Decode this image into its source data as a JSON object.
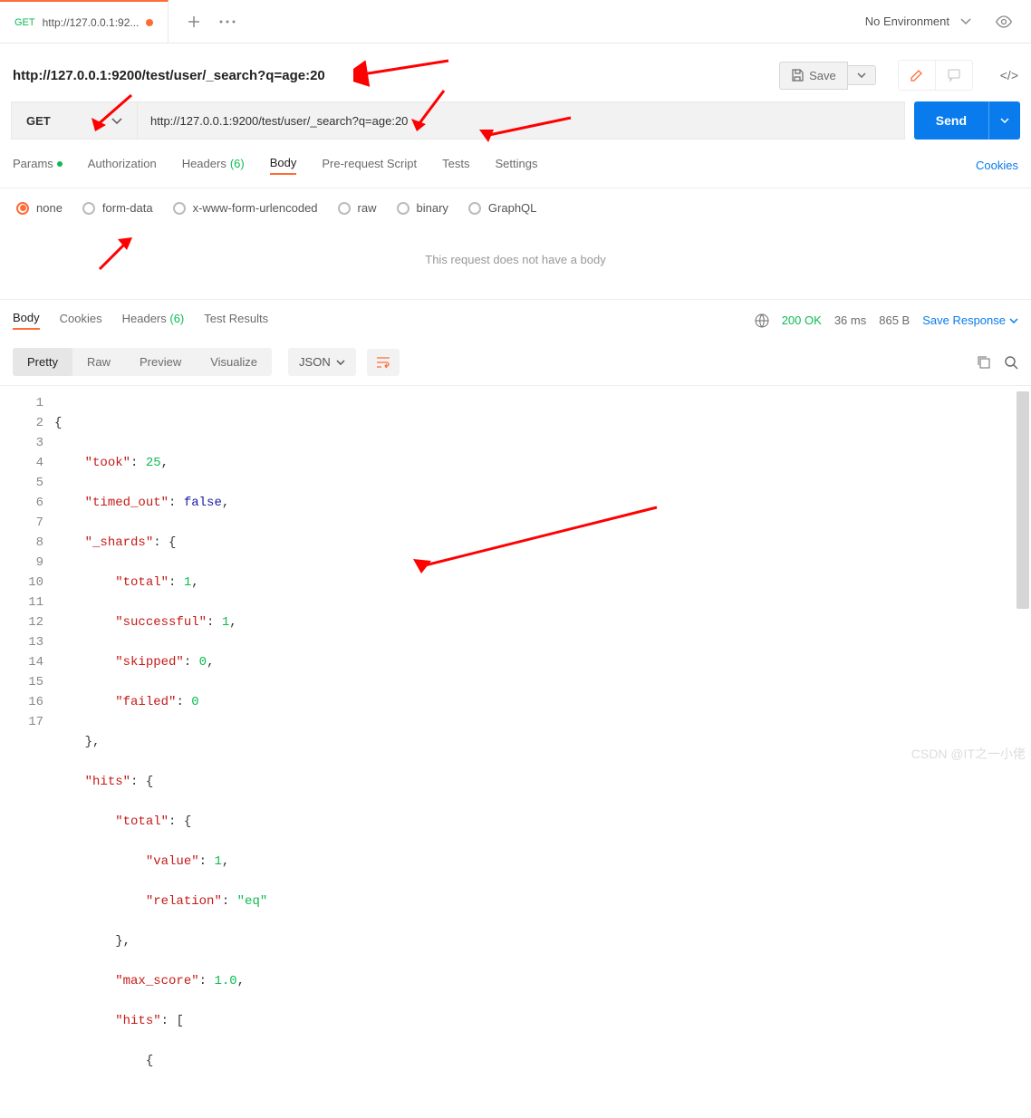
{
  "tab": {
    "method": "GET",
    "title": "http://127.0.0.1:92..."
  },
  "env": {
    "label": "No Environment"
  },
  "request": {
    "title": "http://127.0.0.1:9200/test/user/_search?q=age:20",
    "save_label": "Save",
    "method": "GET",
    "url": "http://127.0.0.1:9200/test/user/_search?q=age:20",
    "send_label": "Send"
  },
  "req_tabs": {
    "params": "Params",
    "auth": "Authorization",
    "headers": "Headers",
    "headers_count": "(6)",
    "body": "Body",
    "prerequest": "Pre-request Script",
    "tests": "Tests",
    "settings": "Settings",
    "cookies": "Cookies"
  },
  "body_types": {
    "none": "none",
    "form_data": "form-data",
    "urlencoded": "x-www-form-urlencoded",
    "raw": "raw",
    "binary": "binary",
    "graphql": "GraphQL"
  },
  "no_body_msg": "This request does not have a body",
  "resp_tabs": {
    "body": "Body",
    "cookies": "Cookies",
    "headers": "Headers",
    "headers_count": "(6)",
    "test_results": "Test Results"
  },
  "resp_meta": {
    "status_code": "200",
    "status_text": "OK",
    "time": "36 ms",
    "size": "865 B",
    "save_response": "Save Response"
  },
  "view_modes": {
    "pretty": "Pretty",
    "raw": "Raw",
    "preview": "Preview",
    "visualize": "Visualize",
    "format": "JSON"
  },
  "response_json": {
    "took": 25,
    "timed_out": false,
    "_shards": {
      "total": 1,
      "successful": 1,
      "skipped": 0,
      "failed": 0
    },
    "hits": {
      "total": {
        "value": 1,
        "relation": "eq"
      },
      "max_score": 1.0,
      "hits": []
    }
  },
  "watermark": "CSDN @IT之一小佬"
}
